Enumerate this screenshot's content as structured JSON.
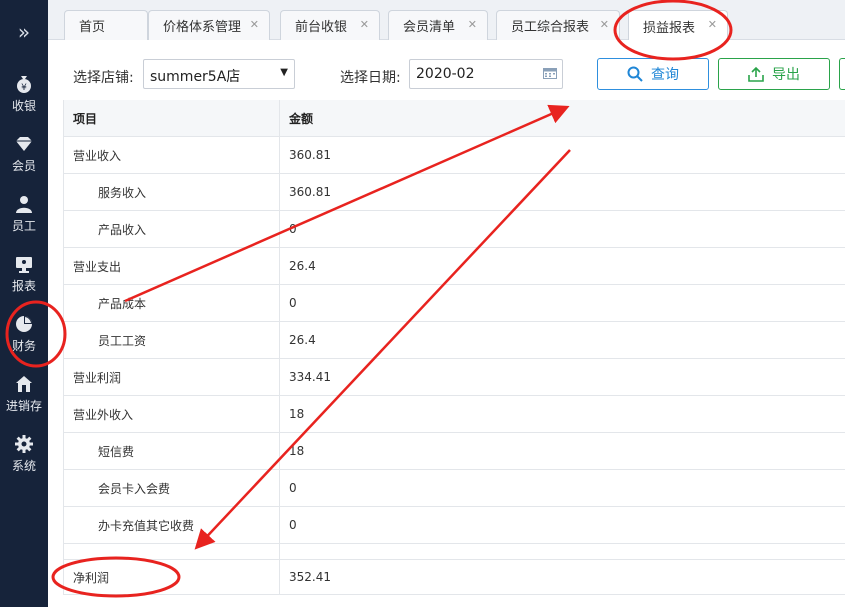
{
  "sidebar": {
    "toggle_icon": "double-chevron-right-icon",
    "items": [
      {
        "label": "收银",
        "icon": "yen-bag-icon"
      },
      {
        "label": "会员",
        "icon": "diamond-icon"
      },
      {
        "label": "员工",
        "icon": "person-icon"
      },
      {
        "label": "报表",
        "icon": "monitor-icon"
      },
      {
        "label": "财务",
        "icon": "pie-chart-icon"
      },
      {
        "label": "进销存",
        "icon": "house-icon"
      },
      {
        "label": "系统",
        "icon": "gear-icon"
      }
    ]
  },
  "tabs": [
    {
      "label": "首页"
    },
    {
      "label": "价格体系管理"
    },
    {
      "label": "前台收银"
    },
    {
      "label": "会员清单"
    },
    {
      "label": "员工综合报表"
    },
    {
      "label": "损益报表",
      "active": true
    }
  ],
  "toolbar": {
    "store_label": "选择店铺:",
    "store_value": "summer5A店",
    "date_label": "选择日期:",
    "date_value": "2020-02",
    "query_label": "查询",
    "export_label": "导出"
  },
  "table": {
    "headers": [
      "项目",
      "金额"
    ],
    "rows": [
      {
        "item": "营业收入",
        "amount": "360.81"
      },
      {
        "item": "服务收入",
        "amount": "360.81"
      },
      {
        "item": "产品收入",
        "amount": "0"
      },
      {
        "item": "营业支出",
        "amount": "26.4"
      },
      {
        "item": "产品成本",
        "amount": "0"
      },
      {
        "item": "员工工资",
        "amount": "26.4"
      },
      {
        "item": "营业利润",
        "amount": "334.41"
      },
      {
        "item": "营业外收入",
        "amount": "18"
      },
      {
        "item": "短信费",
        "amount": "18"
      },
      {
        "item": "会员卡入会费",
        "amount": "0"
      },
      {
        "item": "办卡充值其它收费",
        "amount": "0"
      },
      {
        "item": "净利润",
        "amount": "352.41"
      }
    ]
  },
  "colors": {
    "sidebar_bg": "#16233a",
    "query_blue": "#1f86d6",
    "export_green": "#2aa34a",
    "annotation_red": "#e8231f"
  }
}
